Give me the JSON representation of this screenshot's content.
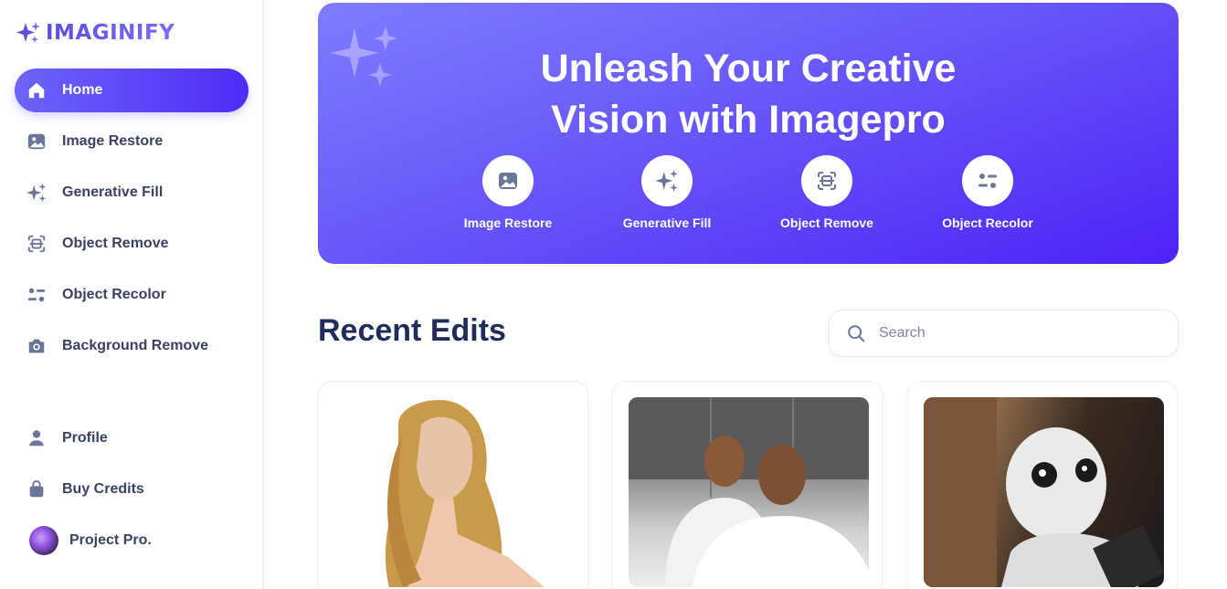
{
  "app": {
    "logo_text": "IMAGINIFY"
  },
  "sidebar": {
    "items": [
      {
        "label": "Home",
        "icon": "home-icon",
        "active": true
      },
      {
        "label": "Image Restore",
        "icon": "image-icon"
      },
      {
        "label": "Generative Fill",
        "icon": "sparkles-icon"
      },
      {
        "label": "Object Remove",
        "icon": "scan-icon"
      },
      {
        "label": "Object Recolor",
        "icon": "filter-icon"
      },
      {
        "label": "Background Remove",
        "icon": "camera-icon"
      }
    ],
    "bottom": [
      {
        "label": "Profile",
        "icon": "user-icon"
      },
      {
        "label": "Buy Credits",
        "icon": "bag-icon"
      }
    ],
    "user": {
      "name": "Project Pro."
    }
  },
  "banner": {
    "title_line1": "Unleash Your Creative",
    "title_line2": "Vision with Imagepro",
    "actions": [
      {
        "label": "Image Restore",
        "icon": "image-icon"
      },
      {
        "label": "Generative Fill",
        "icon": "sparkles-icon"
      },
      {
        "label": "Object Remove",
        "icon": "scan-icon"
      },
      {
        "label": "Object Recolor",
        "icon": "filter-icon"
      }
    ]
  },
  "recent": {
    "title": "Recent Edits",
    "search_placeholder": "Search"
  },
  "colors": {
    "accent": "#5b3cf6",
    "heading": "#1f2d5c",
    "icon_gray": "#6b7499"
  }
}
